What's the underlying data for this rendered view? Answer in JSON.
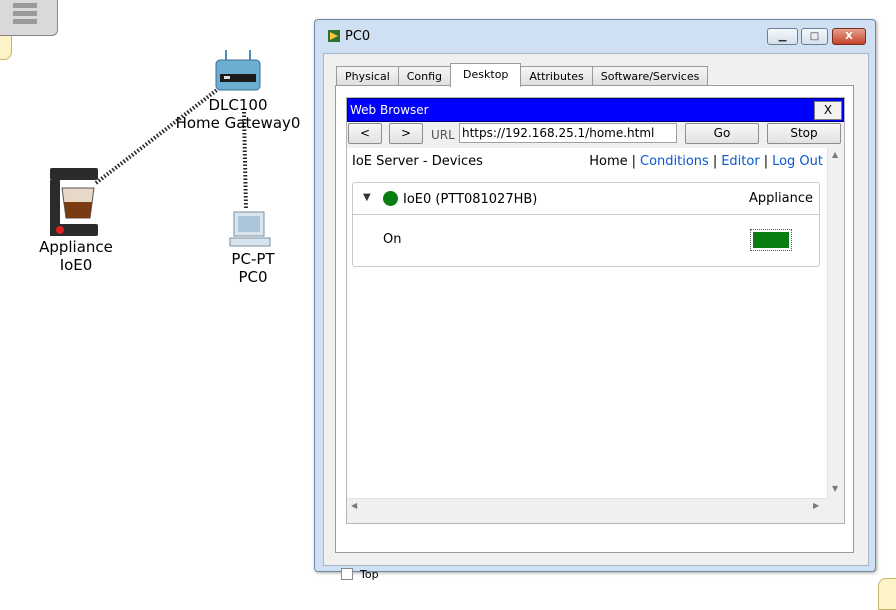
{
  "workspace": {
    "devices": [
      {
        "id": "gateway",
        "line1": "DLC100",
        "line2": "Home Gateway0"
      },
      {
        "id": "appliance",
        "line1": "Appliance",
        "line2": "IoE0"
      },
      {
        "id": "pc",
        "line1": "PC-PT",
        "line2": "PC0"
      }
    ]
  },
  "window": {
    "title": "PC0",
    "controls": {
      "minimize": "▁",
      "maximize": "□",
      "close": "X"
    },
    "tabs": [
      {
        "label": "Physical",
        "active": false
      },
      {
        "label": "Config",
        "active": false
      },
      {
        "label": "Desktop",
        "active": true
      },
      {
        "label": "Attributes",
        "active": false
      },
      {
        "label": "Software/Services",
        "active": false
      }
    ],
    "top_checkbox_label": "Top"
  },
  "browser": {
    "title": "Web Browser",
    "close_label": "X",
    "back_label": "<",
    "forward_label": ">",
    "url_label": "URL",
    "url_value": "https://192.168.25.1/home.html",
    "go_label": "Go",
    "stop_label": "Stop"
  },
  "page": {
    "title": "IoE Server - Devices",
    "nav": {
      "home": "Home",
      "conditions": "Conditions",
      "editor": "Editor",
      "logout": "Log Out"
    },
    "device": {
      "name": "IoE0 (PTT081027HB)",
      "type": "Appliance",
      "status_color": "#0a7d12",
      "property_label": "On",
      "property_value": "on"
    }
  },
  "colors": {
    "accent_blue": "#0000ff",
    "link_blue": "#0b57d0",
    "status_green": "#0a7d12"
  }
}
